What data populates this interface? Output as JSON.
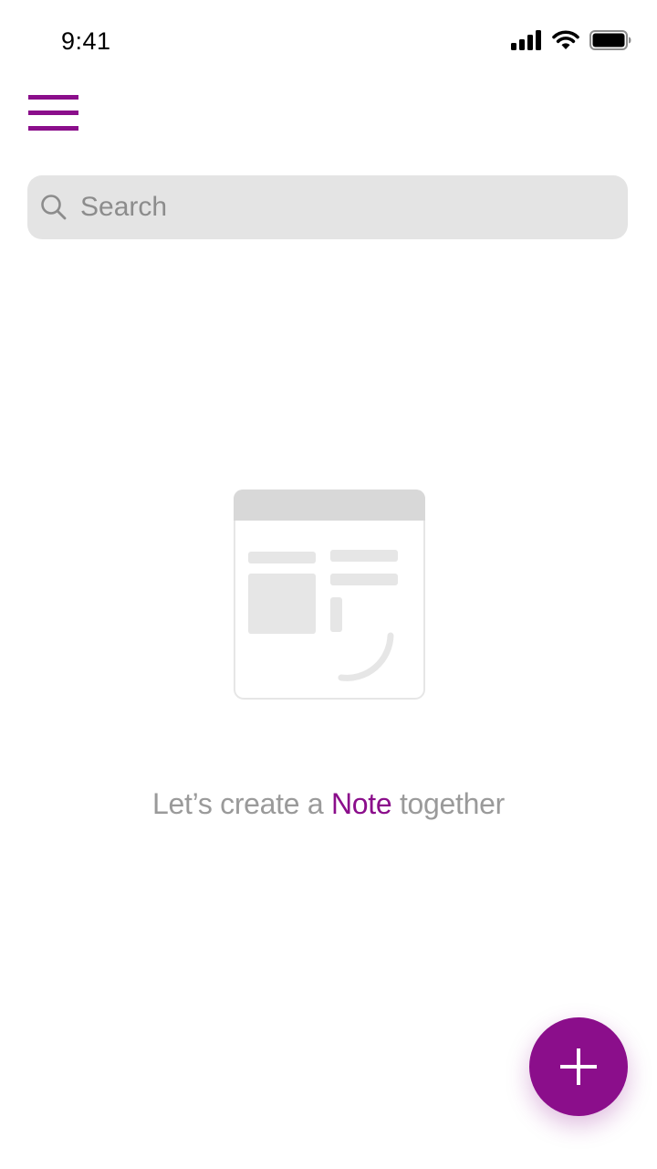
{
  "status_bar": {
    "time": "9:41",
    "icons": [
      "signal-icon",
      "wifi-icon",
      "battery-icon"
    ]
  },
  "header": {
    "menu_icon": "hamburger-menu-icon"
  },
  "search": {
    "placeholder": "Search",
    "value": "",
    "icon": "search-icon"
  },
  "empty_state": {
    "illustration": "empty-note-illustration",
    "text_before": "Let’s create a ",
    "text_accent": "Note",
    "text_after": " together"
  },
  "fab": {
    "icon": "plus-icon"
  },
  "colors": {
    "accent": "#8B0E8B",
    "search_background": "#E4E4E4",
    "muted_text": "#9A9A9A",
    "placeholder_text": "#8C8C8C",
    "illustration_gray": "#E6E6E6",
    "illustration_header": "#D8D8D8"
  }
}
